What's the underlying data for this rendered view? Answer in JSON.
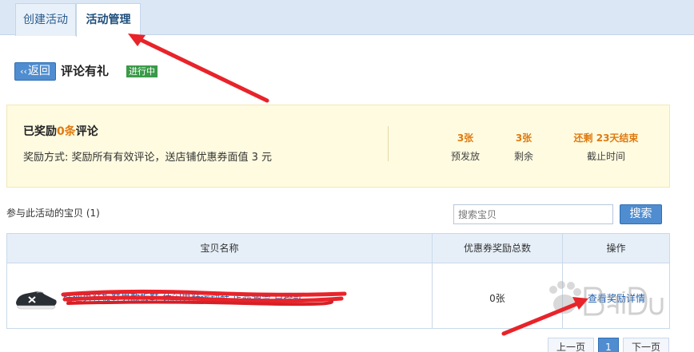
{
  "tabs": [
    {
      "label": "创建活动",
      "active": false
    },
    {
      "label": "活动管理",
      "active": true
    }
  ],
  "header": {
    "back_label": "返回",
    "back_chevron": "‹‹",
    "title": "评论有礼",
    "status": "进行中"
  },
  "summary": {
    "rewarded_prefix": "已奖励",
    "rewarded_count": "0条",
    "rewarded_suffix": "评论",
    "method": "奖励方式: 奖励所有有效评论，送店铺优惠券面值 3 元",
    "stats": {
      "issued": {
        "value": "3张",
        "label": "预发放"
      },
      "remaining": {
        "value": "3张",
        "label": "剩余"
      },
      "deadline": {
        "value": "还剩 23天结束",
        "label": "截止时间"
      }
    }
  },
  "list": {
    "caption": "参与此活动的宝贝 (1)",
    "search_placeholder": "搜索宝贝",
    "search_button": "搜索",
    "columns": [
      "宝贝名称",
      "优惠券奖励总数",
      "操作"
    ],
    "rows": [
      {
        "name": "旺迪男鞋板鞋男款板鞋 休闲男鞋运动鞋 正品潮流 百搭款",
        "coupon_total": "0张",
        "action": "查看奖励详情"
      }
    ]
  },
  "pager": {
    "prev": "上一页",
    "current": "1",
    "next": "下一页"
  },
  "colors": {
    "accent": "#4f8dd0",
    "highlight": "#e07a10",
    "annotation": "#e8232a",
    "status": "#3b9a49"
  }
}
